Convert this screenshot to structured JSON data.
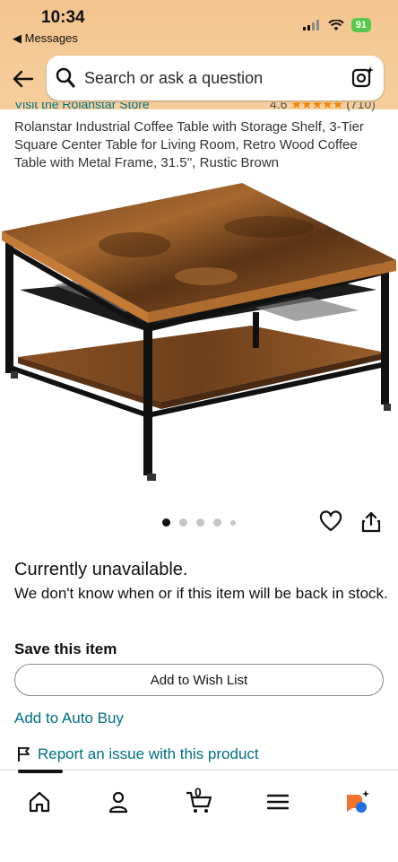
{
  "status_bar": {
    "time": "10:34",
    "back_app_label": "◀ Messages",
    "battery": "91"
  },
  "search": {
    "placeholder": "Search or ask a question"
  },
  "product": {
    "store_link": "Visit the Rolanstar Store",
    "rating_value": "4.6",
    "rating_stars": "★★★★★",
    "rating_count": "(710)",
    "title": "Rolanstar Industrial Coffee Table with Storage Shelf, 3-Tier Square Center Table for Living Room, Retro Wood Coffee Table with Metal Frame, 31.5'', Rustic Brown",
    "image_alt": "Square coffee table with rustic brown wood top, black metal frame, and mesh storage shelf",
    "image_count": 5,
    "active_image_index": 0
  },
  "availability": {
    "status": "Currently unavailable.",
    "note": "We don't know when or if this item will be back in stock."
  },
  "save": {
    "heading": "Save this item",
    "wish_list_label": "Add to Wish List"
  },
  "links": {
    "auto_buy": "Add to Auto Buy",
    "report_issue": "Report an issue with this product"
  },
  "bottom_nav": {
    "items": [
      "home-icon",
      "account-icon",
      "cart-icon",
      "menu-icon",
      "rufus-icon"
    ],
    "cart_count": "0"
  },
  "colors": {
    "header_bg": "#f3c58f",
    "link": "#007185",
    "star": "#f08804",
    "battery": "#57c84d"
  }
}
